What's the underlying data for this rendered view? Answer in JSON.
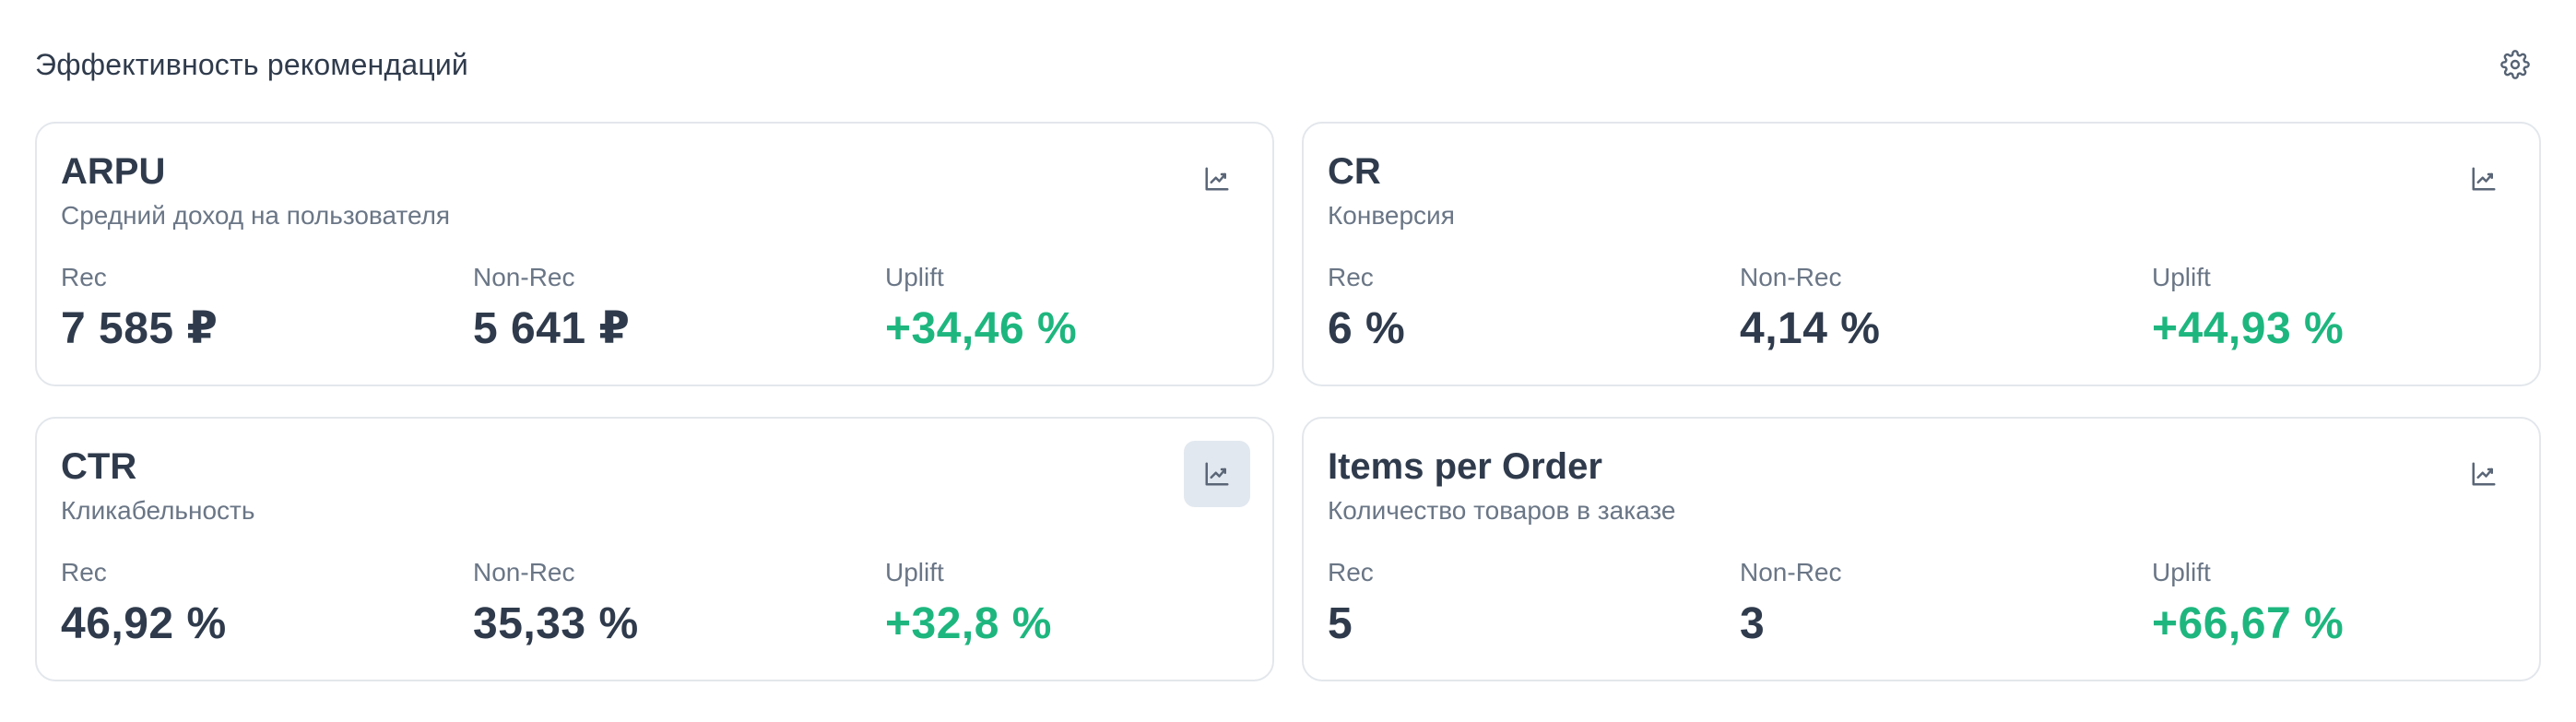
{
  "header": {
    "title": "Эффективность рекомендаций"
  },
  "labels": {
    "rec": "Rec",
    "non_rec": "Non-Rec",
    "uplift": "Uplift"
  },
  "cards": [
    {
      "title": "ARPU",
      "subtitle": "Средний доход на пользователя",
      "rec": "7 585 ₽",
      "non_rec": "5 641 ₽",
      "uplift": "+34,46 %"
    },
    {
      "title": "CR",
      "subtitle": "Конверсия",
      "rec": "6 %",
      "non_rec": "4,14 %",
      "uplift": "+44,93 %"
    },
    {
      "title": "CTR",
      "subtitle": "Кликабельность",
      "rec": "46,92 %",
      "non_rec": "35,33 %",
      "uplift": "+32,8 %"
    },
    {
      "title": "Items per Order",
      "subtitle": "Количество товаров в заказе",
      "rec": "5",
      "non_rec": "3",
      "uplift": "+66,67 %"
    }
  ],
  "colors": {
    "uplift": "#1eb67f",
    "text": "#2f3b4c",
    "muted": "#6a7686",
    "border": "#e3e7ec",
    "active_button": "#e2e8ef"
  },
  "icons": {
    "settings": "gear-icon",
    "chart": "trend-chart-icon"
  }
}
